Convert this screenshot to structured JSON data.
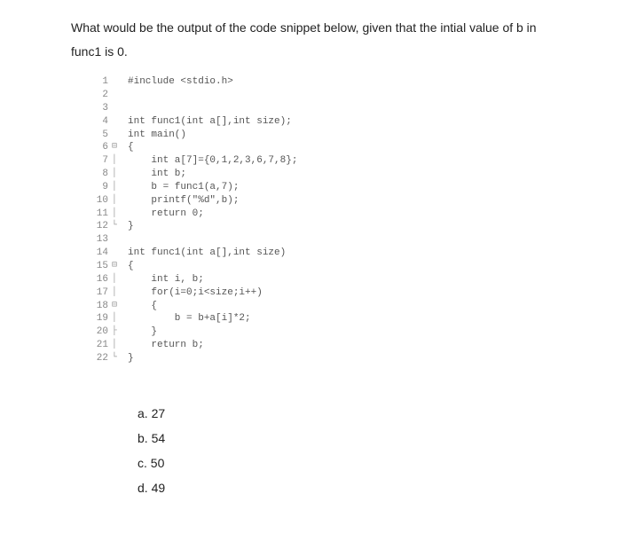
{
  "question": {
    "line1": "What would be the output of the code snippet below, given that the intial value of b in",
    "line2": "func1 is 0."
  },
  "code": [
    {
      "n": "1",
      "g": "",
      "t": "#include <stdio.h>"
    },
    {
      "n": "2",
      "g": "",
      "t": ""
    },
    {
      "n": "3",
      "g": "",
      "t": ""
    },
    {
      "n": "4",
      "g": "",
      "t": "int func1(int a[],int size);"
    },
    {
      "n": "5",
      "g": "",
      "t": "int main()"
    },
    {
      "n": "6",
      "g": "⊟",
      "t": "{"
    },
    {
      "n": "7",
      "g": "│",
      "t": "    int a[7]={0,1,2,3,6,7,8};"
    },
    {
      "n": "8",
      "g": "│",
      "t": "    int b;"
    },
    {
      "n": "9",
      "g": "│",
      "t": "    b = func1(a,7);"
    },
    {
      "n": "10",
      "g": "│",
      "t": "    printf(\"%d\",b);"
    },
    {
      "n": "11",
      "g": "│",
      "t": "    return 0;"
    },
    {
      "n": "12",
      "g": "└",
      "t": "}"
    },
    {
      "n": "13",
      "g": "",
      "t": ""
    },
    {
      "n": "14",
      "g": "",
      "t": "int func1(int a[],int size)"
    },
    {
      "n": "15",
      "g": "⊟",
      "t": "{"
    },
    {
      "n": "16",
      "g": "│",
      "t": "    int i, b;"
    },
    {
      "n": "17",
      "g": "│",
      "t": "    for(i=0;i<size;i++)"
    },
    {
      "n": "18",
      "g": "⊟",
      "t": "    {"
    },
    {
      "n": "19",
      "g": "│",
      "t": "        b = b+a[i]*2;"
    },
    {
      "n": "20",
      "g": "├",
      "t": "    }"
    },
    {
      "n": "21",
      "g": "│",
      "t": "    return b;"
    },
    {
      "n": "22",
      "g": "└",
      "t": "}"
    },
    {
      "n": "",
      "g": "",
      "t": ""
    }
  ],
  "options": {
    "a": "a. 27",
    "b": "b. 54",
    "c": "c. 50",
    "d": "d. 49"
  }
}
